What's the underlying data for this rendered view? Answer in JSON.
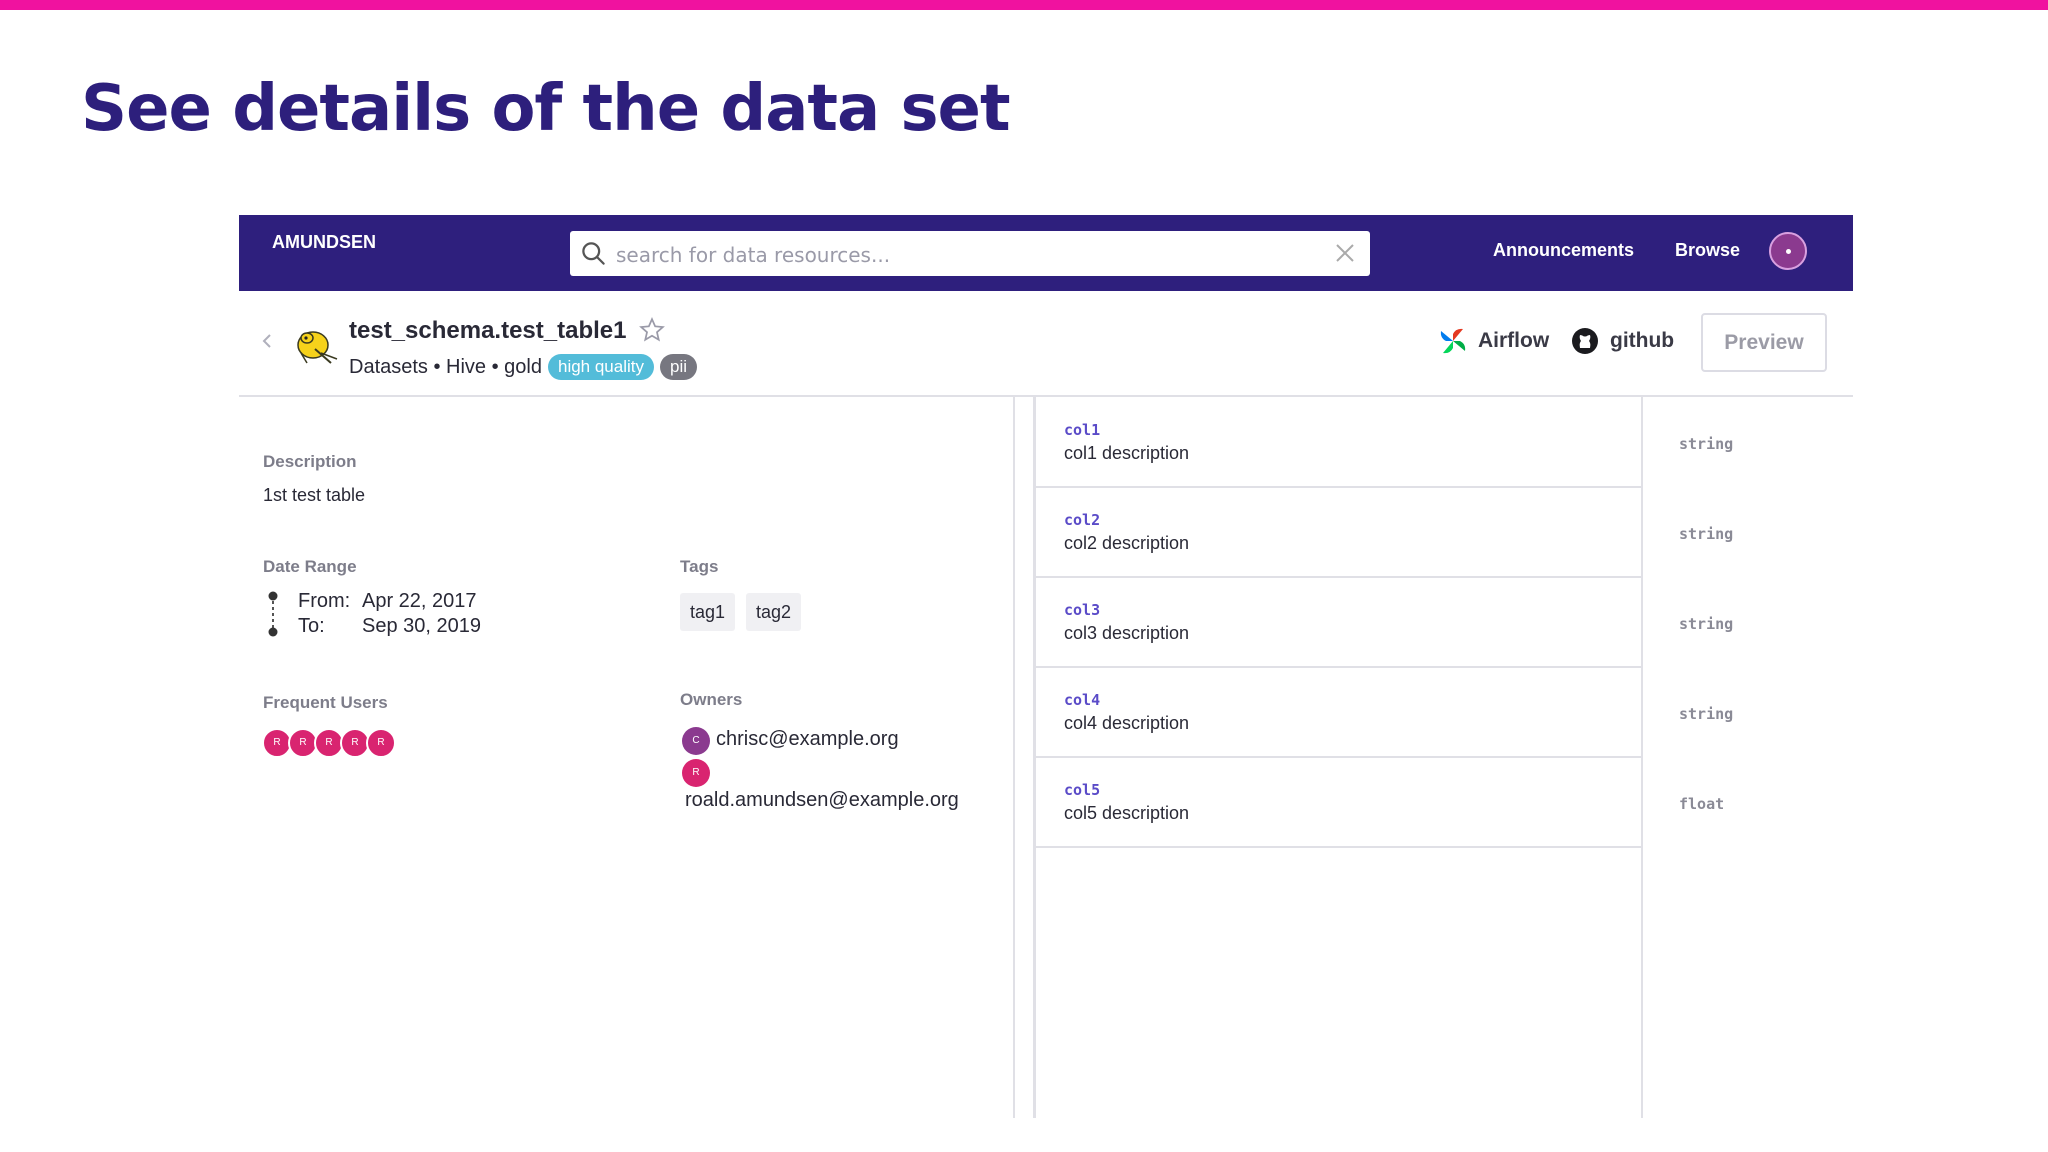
{
  "slide": {
    "title": "See details of the data set"
  },
  "navbar": {
    "brand": "AMUNDSEN",
    "search_placeholder": "search for data resources...",
    "announcements": "Announcements",
    "browse": "Browse"
  },
  "table": {
    "name": "test_schema.test_table1",
    "breadcrumb": "Datasets • Hive • gold",
    "badges": [
      "high quality",
      "pii"
    ]
  },
  "links": {
    "airflow": "Airflow",
    "github": "github",
    "preview": "Preview"
  },
  "details": {
    "description_label": "Description",
    "description": "1st test table",
    "date_range_label": "Date Range",
    "from_label": "From:",
    "from_value": "Apr 22, 2017",
    "to_label": "To:",
    "to_value": "Sep 30, 2019",
    "tags_label": "Tags",
    "tags": [
      "tag1",
      "tag2"
    ],
    "frequent_users_label": "Frequent Users",
    "frequent_users": [
      "R",
      "R",
      "R",
      "R",
      "R"
    ],
    "owners_label": "Owners",
    "owners": [
      {
        "initial": "C",
        "email": "chrisc@example.org"
      },
      {
        "initial": "R",
        "email": "roald.amundsen@example.org"
      }
    ]
  },
  "columns": [
    {
      "name": "col1",
      "description": "col1 description",
      "type": "string"
    },
    {
      "name": "col2",
      "description": "col2 description",
      "type": "string"
    },
    {
      "name": "col3",
      "description": "col3 description",
      "type": "string"
    },
    {
      "name": "col4",
      "description": "col4 description",
      "type": "string"
    },
    {
      "name": "col5",
      "description": "col5 description",
      "type": "float"
    }
  ],
  "colors": {
    "accent_bar": "#f0129f",
    "title": "#2d1f7c",
    "navbar": "#2e1f7d",
    "badge_high_quality": "#53bcd9",
    "badge_pii": "#777780",
    "user_avatar": "#d92470",
    "owner_c_avatar": "#8b3a8f",
    "column_name": "#5a4bc8"
  }
}
